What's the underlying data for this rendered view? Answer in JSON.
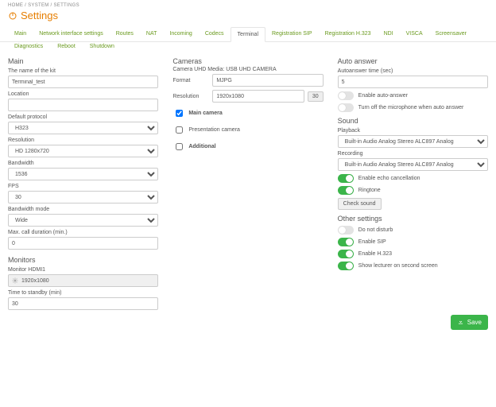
{
  "breadcrumb": "HOME / SYSTEM / SETTINGS",
  "page_title": "Settings",
  "tabs": [
    "Main",
    "Network interface settings",
    "Routes",
    "NAT",
    "Incoming",
    "Codecs",
    "Terminal",
    "Registration SIP",
    "Registration H.323",
    "NDI",
    "VISCA",
    "Screensaver"
  ],
  "active_tab": "Terminal",
  "subtabs": [
    "Diagnostics",
    "Reboot",
    "Shutdown"
  ],
  "main": {
    "heading": "Main",
    "name_label": "The name of the kit",
    "name_value": "Terminal_test",
    "location_label": "Location",
    "location_value": "",
    "protocol_label": "Default protocol",
    "protocol_value": "H323",
    "resolution_label": "Resolution",
    "resolution_value": "HD 1280x720",
    "bandwidth_label": "Bandwidth",
    "bandwidth_value": "1536",
    "fps_label": "FPS",
    "fps_value": "30",
    "bwmode_label": "Bandwidth mode",
    "bwmode_value": "Wide",
    "maxcall_label": "Max. call duration (min.)",
    "maxcall_value": "0",
    "monitors_heading": "Monitors",
    "monitor_label": "Monitor HDMI1",
    "monitor_value": "1920x1080",
    "standby_label": "Time to standby (min)",
    "standby_value": "30"
  },
  "cameras": {
    "heading": "Cameras",
    "cam_title": "Camera UHD Media: USB UHD CAMERA",
    "format_label": "Format",
    "format_value": "MJPG",
    "res_label": "Resolution",
    "res_value": "1920x1080",
    "res_tag": "30",
    "main_camera": "Main camera",
    "presentation_camera": "Presentation camera",
    "additional": "Additional"
  },
  "auto": {
    "heading": "Auto answer",
    "time_label": "Autoanswer time (sec)",
    "time_value": "5",
    "enable": "Enable auto-answer",
    "mute": "Turn off the microphone when auto answer"
  },
  "sound": {
    "heading": "Sound",
    "playback_label": "Playback",
    "playback_value": "Built-in Audio Analog Stereo ALC897 Analog",
    "recording_label": "Recording",
    "recording_value": "Built-in Audio Analog Stereo ALC897 Analog",
    "echo": "Enable echo cancellation",
    "ringtone": "Ringtone",
    "check": "Check sound"
  },
  "other": {
    "heading": "Other settings",
    "dnd": "Do not disturb",
    "sip": "Enable SIP",
    "h323": "Enable H.323",
    "lect": "Show lecturer on second screen"
  },
  "save": "Save"
}
